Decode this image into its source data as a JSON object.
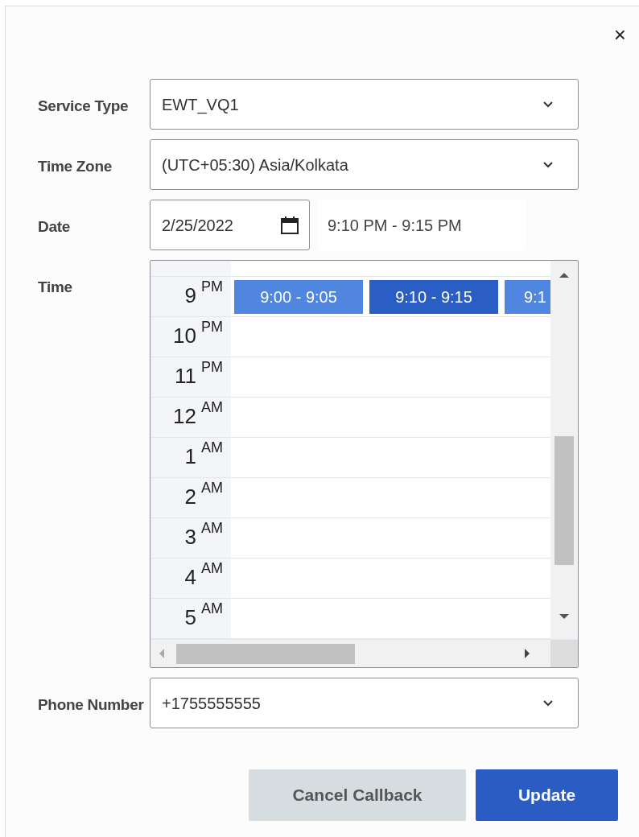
{
  "close": "×",
  "fields": [
    {
      "label": "Service Type",
      "value": "EWT_VQ1"
    },
    {
      "label": "Time Zone",
      "value": "(UTC+05:30) Asia/Kolkata"
    }
  ],
  "date": {
    "label": "Date",
    "value": "2/25/2022",
    "range": "9:10 PM - 9:15 PM"
  },
  "time": {
    "label": "Time",
    "hours": [
      {
        "hour": "9",
        "period": "PM",
        "slots": [
          {
            "label": "9:00 - 9:05",
            "selected": false
          },
          {
            "label": "9:10 - 9:15",
            "selected": true
          },
          {
            "label": "9:1",
            "selected": false
          }
        ]
      },
      {
        "hour": "10",
        "period": "PM"
      },
      {
        "hour": "11",
        "period": "PM"
      },
      {
        "hour": "12",
        "period": "AM"
      },
      {
        "hour": "1",
        "period": "AM"
      },
      {
        "hour": "2",
        "period": "AM"
      },
      {
        "hour": "3",
        "period": "AM"
      },
      {
        "hour": "4",
        "period": "AM"
      },
      {
        "hour": "5",
        "period": "AM"
      }
    ]
  },
  "phone": {
    "label": "Phone Number",
    "value": "+1755555555"
  },
  "buttons": [
    {
      "label": "Cancel Callback",
      "kind": "secondary"
    },
    {
      "label": "Update",
      "kind": "primary"
    }
  ]
}
